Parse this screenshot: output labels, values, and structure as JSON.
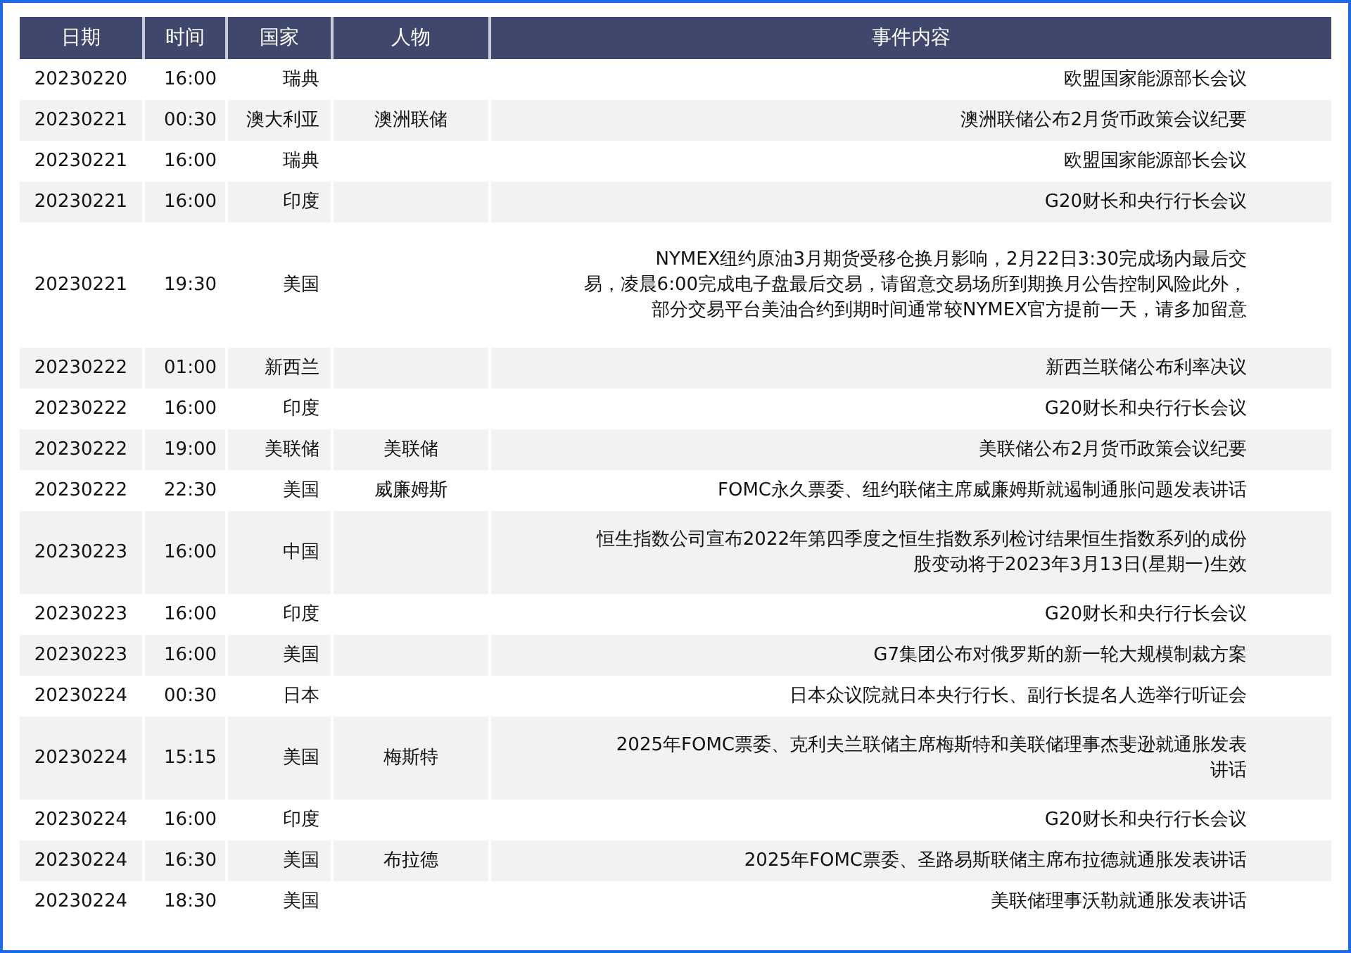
{
  "table": {
    "columns": [
      "日期",
      "时间",
      "国家",
      "人物",
      "事件内容"
    ],
    "rows": [
      {
        "date": "20230220",
        "time": "16:00",
        "country": "瑞典",
        "event": [
          "欧盟国家能源部长会议"
        ]
      },
      {
        "date": "20230221",
        "time": "00:30",
        "country": "澳大利亚",
        "person": "澳洲联储",
        "event": [
          "澳洲联储公布2月货币政策会议纪要"
        ]
      },
      {
        "date": "20230221",
        "time": "16:00",
        "country": "瑞典",
        "event": [
          "欧盟国家能源部长会议"
        ]
      },
      {
        "date": "20230221",
        "time": "16:00",
        "country": "印度",
        "event": [
          "G20财长和央行行长会议"
        ]
      },
      {
        "date": "20230221",
        "time": "19:30",
        "country": "美国",
        "event": [
          "NYMEX纽约原油3月期货受移仓换月影响，2月22日3:30完成场内最后交",
          "易，凌晨6:00完成电子盘最后交易，请留意交易场所到期换月公告控制风险此外，",
          "部分交易平台美油合约到期时间通常较NYMEX官方提前一天，请多加留意"
        ]
      },
      {
        "date": "20230222",
        "time": "01:00",
        "country": "新西兰",
        "event": [
          "新西兰联储公布利率决议"
        ]
      },
      {
        "date": "20230222",
        "time": "16:00",
        "country": "印度",
        "event": [
          "G20财长和央行行长会议"
        ]
      },
      {
        "date": "20230222",
        "time": "19:00",
        "country": "美联储",
        "person": "美联储",
        "event": [
          "美联储公布2月货币政策会议纪要"
        ]
      },
      {
        "date": "20230222",
        "time": "22:30",
        "country": "美国",
        "person": "威廉姆斯",
        "event": [
          "FOMC永久票委、纽约联储主席威廉姆斯就遏制通胀问题发表讲话"
        ]
      },
      {
        "date": "20230223",
        "time": "16:00",
        "country": "中国",
        "event": [
          "恒生指数公司宣布2022年第四季度之恒生指数系列检讨结果恒生指数系列的成份",
          "股变动将于2023年3月13日(星期一)生效"
        ]
      },
      {
        "date": "20230223",
        "time": "16:00",
        "country": "印度",
        "event": [
          "G20财长和央行行长会议"
        ]
      },
      {
        "date": "20230223",
        "time": "16:00",
        "country": "美国",
        "event": [
          "G7集团公布对俄罗斯的新一轮大规模制裁方案"
        ]
      },
      {
        "date": "20230224",
        "time": "00:30",
        "country": "日本",
        "event": [
          "日本众议院就日本央行行长、副行长提名人选举行听证会"
        ]
      },
      {
        "date": "20230224",
        "time": "15:15",
        "country": "美国",
        "person": "梅斯特",
        "event": [
          "2025年FOMC票委、克利夫兰联储主席梅斯特和美联储理事杰斐逊就通胀发表",
          "讲话"
        ]
      },
      {
        "date": "20230224",
        "time": "16:00",
        "country": "印度",
        "event": [
          "G20财长和央行行长会议"
        ]
      },
      {
        "date": "20230224",
        "time": "16:30",
        "country": "美国",
        "person": "布拉德",
        "event": [
          "2025年FOMC票委、圣路易斯联储主席布拉德就通胀发表讲话"
        ]
      },
      {
        "date": "20230224",
        "time": "18:30",
        "country": "美国",
        "event": [
          "美联储理事沃勒就通胀发表讲话"
        ]
      }
    ]
  }
}
